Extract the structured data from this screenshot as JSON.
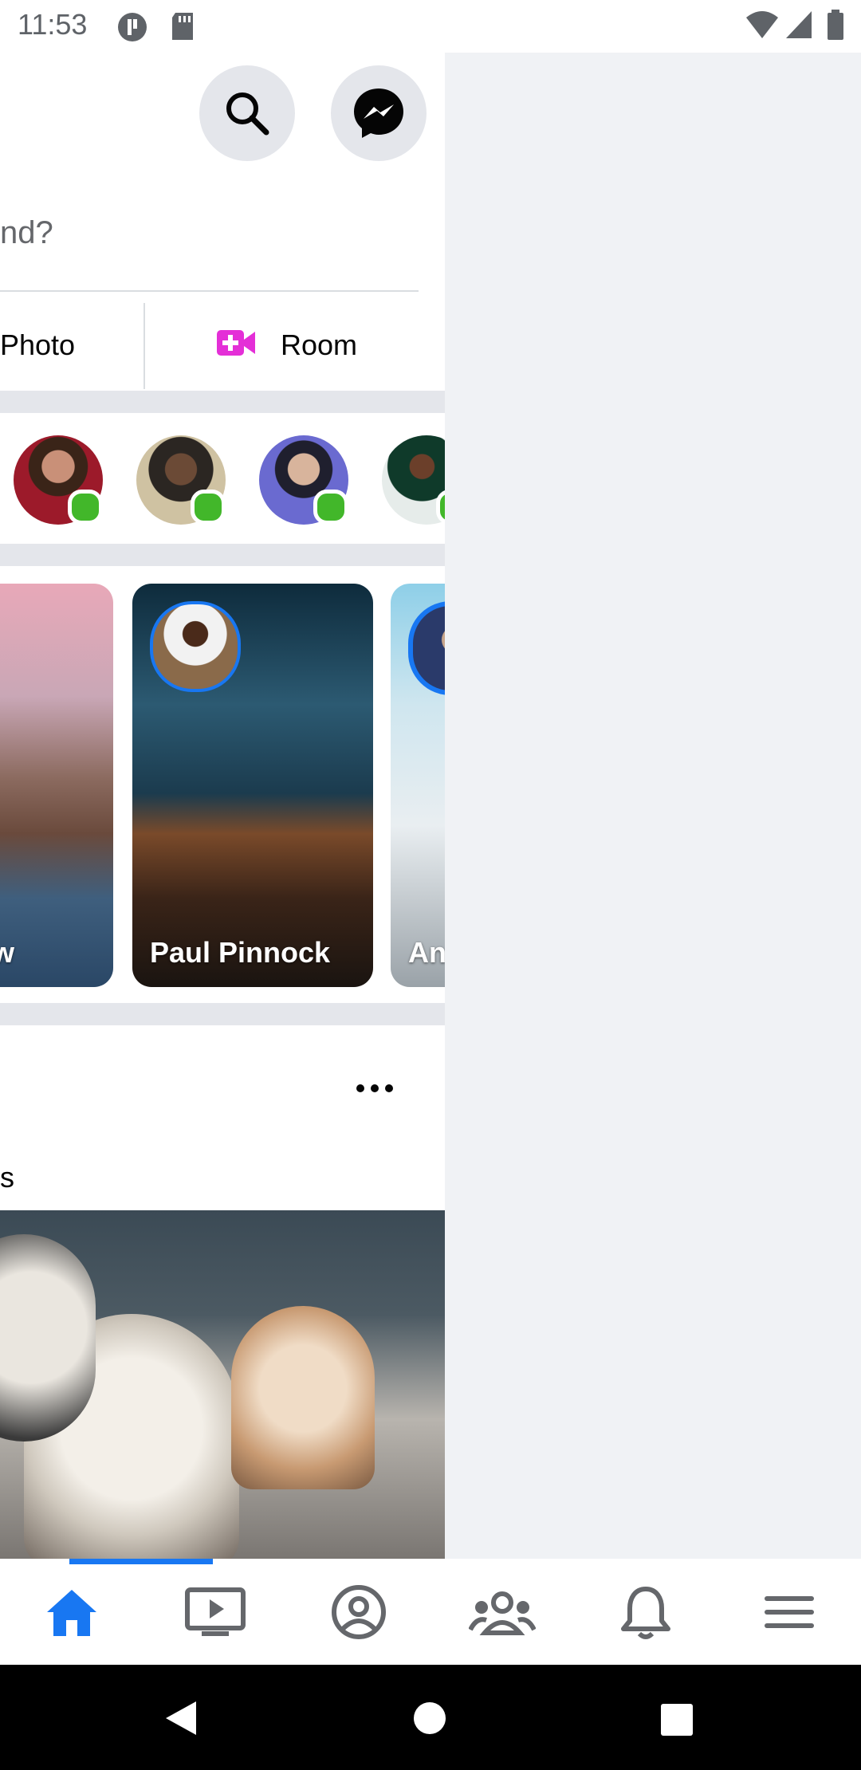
{
  "status_bar": {
    "time": "11:53"
  },
  "composer": {
    "prompt_partial": "nd?",
    "photo_label": "Photo",
    "room_label": "Room",
    "room_icon_color": "#e42fd7"
  },
  "stories": [
    {
      "name_partial": "w"
    },
    {
      "name": "Paul Pinnock"
    },
    {
      "name_partial": "An"
    }
  ],
  "post": {
    "text_partial": "s"
  },
  "icons": {
    "header": [
      "search-icon",
      "messenger-icon"
    ],
    "bottom_nav": [
      "home-icon",
      "watch-icon",
      "profile-icon",
      "groups-icon",
      "notifications-icon",
      "menu-icon"
    ]
  },
  "colors": {
    "accent": "#1877f2",
    "online": "#42b72a",
    "inactive_icon": "#65676b"
  }
}
